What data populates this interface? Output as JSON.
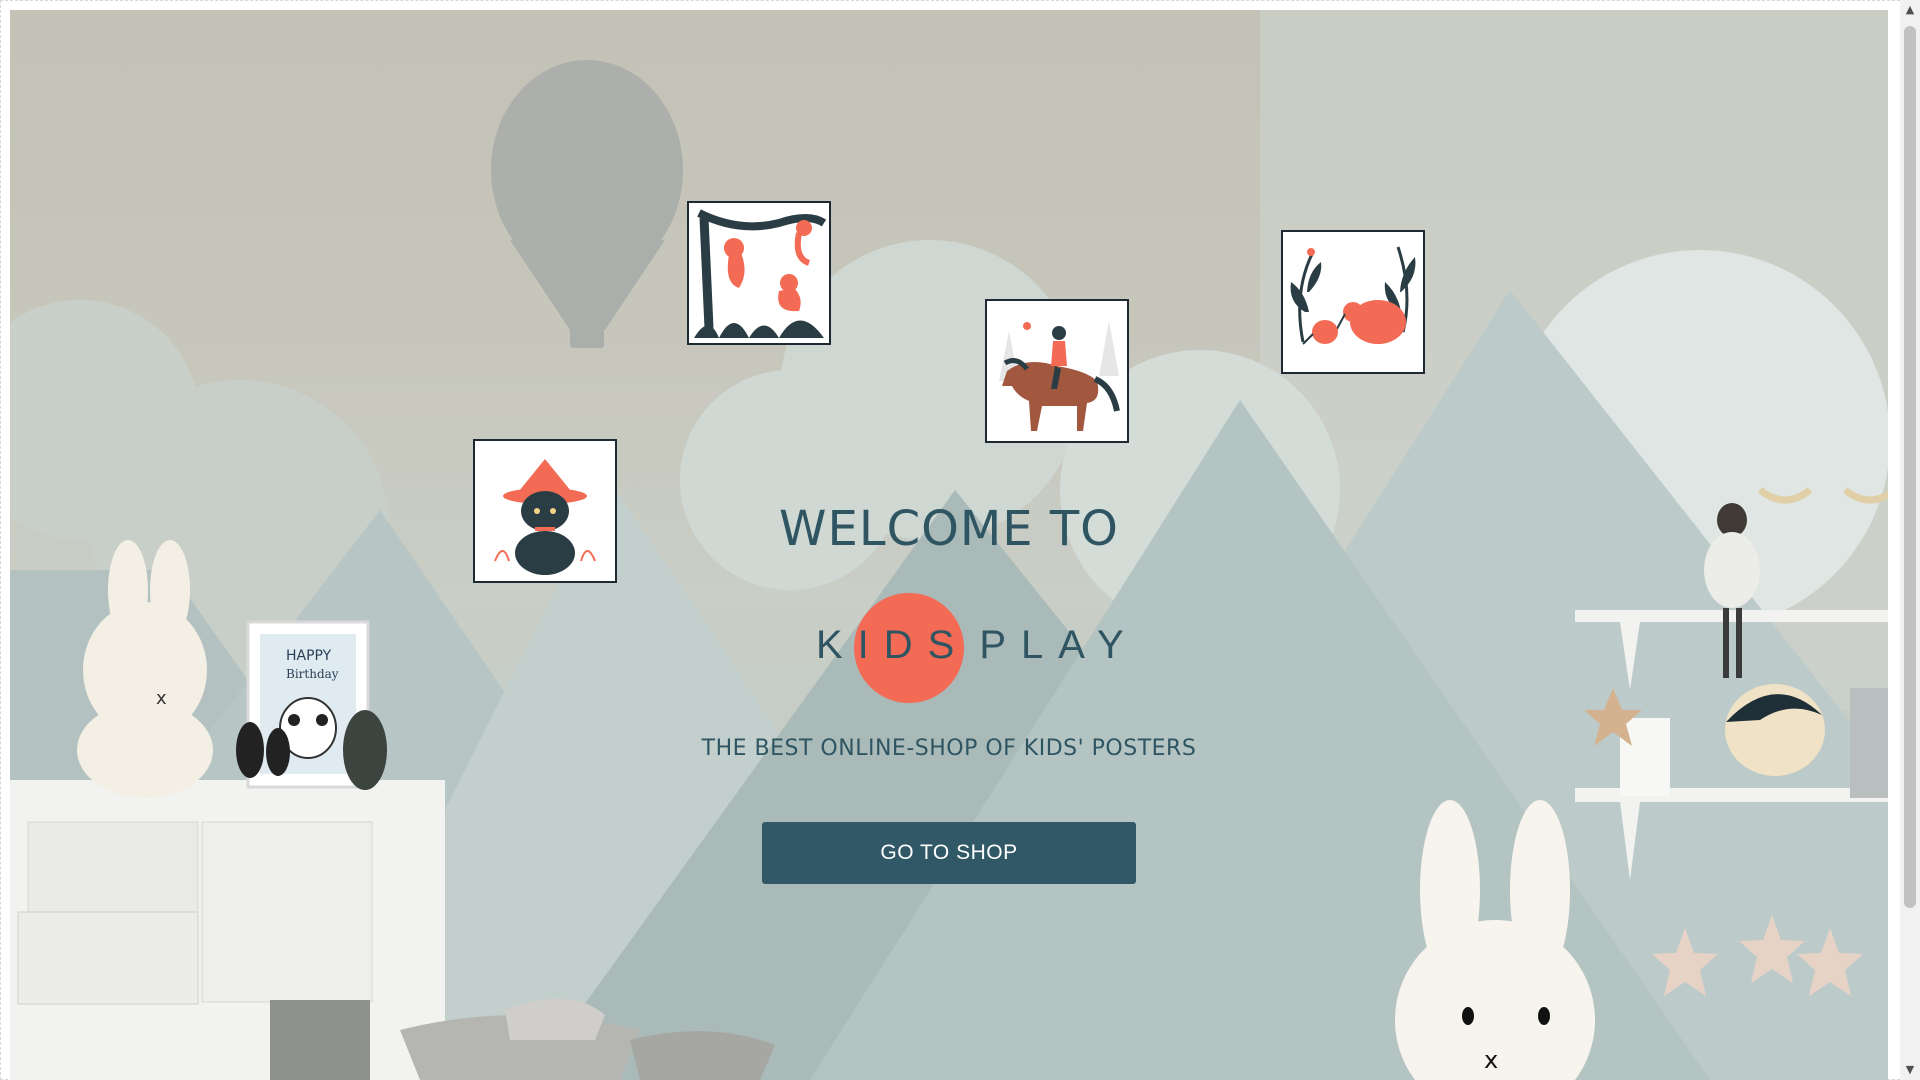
{
  "hero": {
    "welcome": "WELCOME TO",
    "brand_kids": "KIDS",
    "brand_play": "PLAY",
    "tagline": "THE BEST ONLINE-SHOP OF KIDS' POSTERS",
    "cta_label": "GO TO SHOP",
    "decor": {
      "frame_text_line1": "HAPPY",
      "frame_text_line2": "Birthday"
    }
  },
  "posters": [
    {
      "subject": "monkeys-in-tree"
    },
    {
      "subject": "girl-riding-horse"
    },
    {
      "subject": "kiwi-birds"
    },
    {
      "subject": "cat-with-hat"
    }
  ],
  "colors": {
    "accent": "#f36b55",
    "primary": "#315866",
    "text": "#2f5563"
  },
  "scrollbar": {
    "up_icon": "▲",
    "down_icon": "▼"
  }
}
